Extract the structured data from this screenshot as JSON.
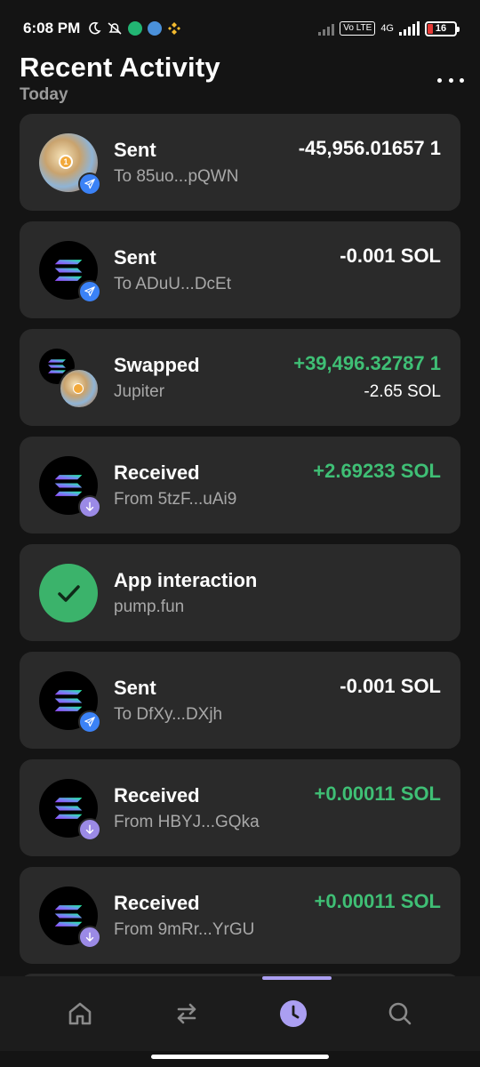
{
  "status_bar": {
    "time": "6:08 PM",
    "network": "4G",
    "volte": "Vo LTE",
    "battery": "16"
  },
  "header": {
    "title": "Recent Activity",
    "section": "Today"
  },
  "colors": {
    "background": "#141414",
    "card": "#2a2a2a",
    "positive": "#3fbf75",
    "accent": "#ab9ff2",
    "send_badge": "#3b82f6",
    "receive_badge": "#9b8ae6"
  },
  "transactions": [
    {
      "type": "Sent",
      "detail": "To 85uo...pQWN",
      "amount": "-45,956.01657 1",
      "icon": "token-image",
      "badge": "paper-plane-icon"
    },
    {
      "type": "Sent",
      "detail": "To ADuU...DcEt",
      "amount": "-0.001 SOL",
      "icon": "solana-icon",
      "badge": "paper-plane-icon"
    },
    {
      "type": "Swapped",
      "detail": "Jupiter",
      "amount": "+39,496.32787 1",
      "amount2": "-2.65 SOL",
      "icon": "swap-pair"
    },
    {
      "type": "Received",
      "detail": "From 5tzF...uAi9",
      "amount": "+2.69233 SOL",
      "icon": "solana-icon",
      "badge": "arrow-down-icon"
    },
    {
      "type": "App interaction",
      "detail": "pump.fun",
      "amount": "",
      "icon": "check-icon"
    },
    {
      "type": "Sent",
      "detail": "To DfXy...DXjh",
      "amount": "-0.001 SOL",
      "icon": "solana-icon",
      "badge": "paper-plane-icon"
    },
    {
      "type": "Received",
      "detail": "From HBYJ...GQka",
      "amount": "+0.00011 SOL",
      "icon": "solana-icon",
      "badge": "arrow-down-icon"
    },
    {
      "type": "Received",
      "detail": "From 9mRr...YrGU",
      "amount": "+0.00011 SOL",
      "icon": "solana-icon",
      "badge": "arrow-down-icon"
    }
  ],
  "nav": {
    "items": [
      "home-icon",
      "swap-icon",
      "clock-icon",
      "search-icon"
    ],
    "active": "clock-icon"
  }
}
